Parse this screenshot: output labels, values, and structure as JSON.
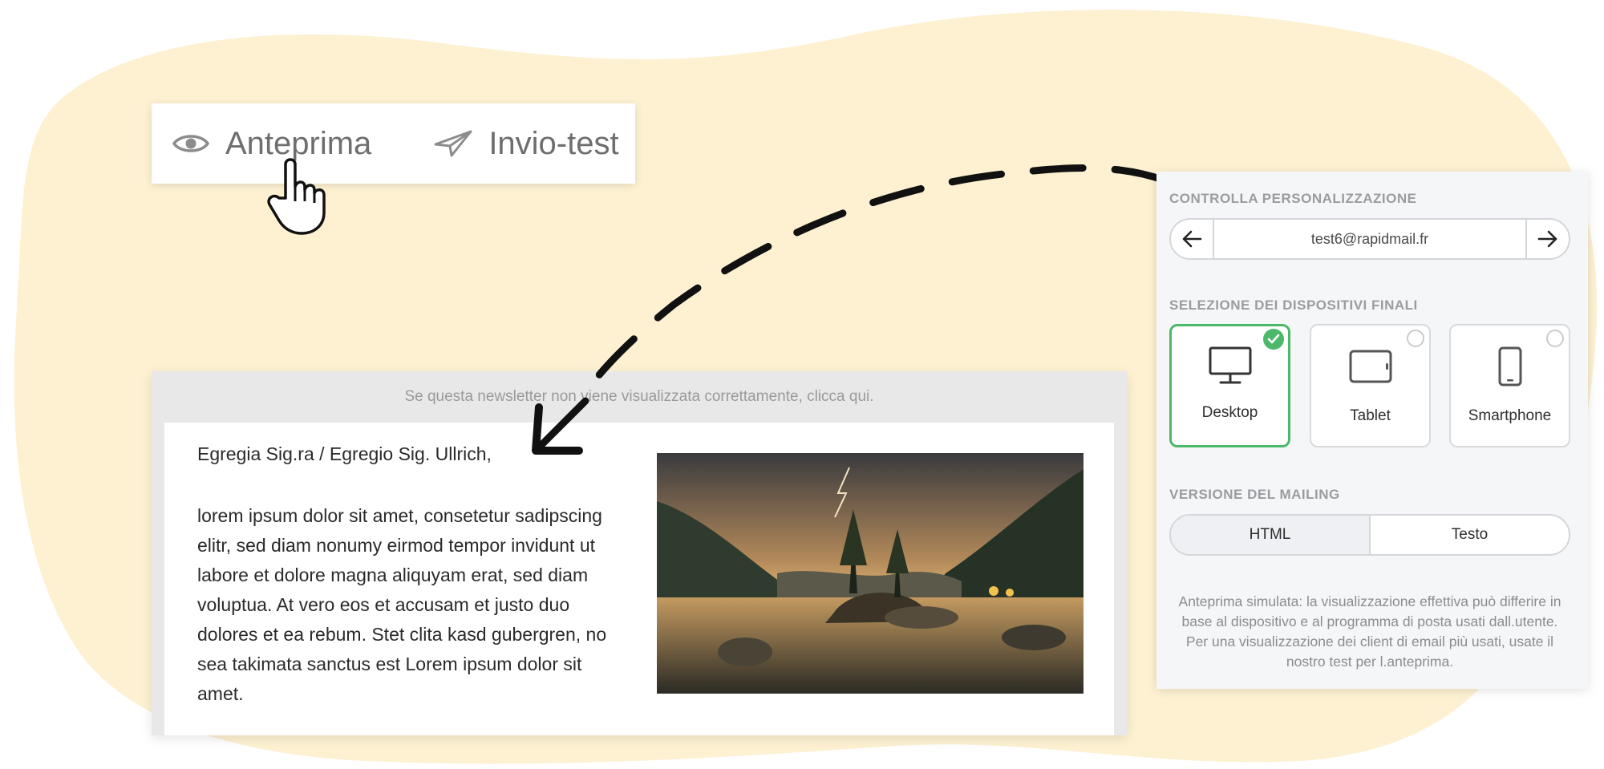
{
  "toolbar": {
    "preview_label": "Anteprima",
    "test_label": "Invio-test"
  },
  "preview": {
    "notice": "Se questa newsletter non viene visualizzata correttamente, clicca qui.",
    "greeting": "Egregia Sig.ra / Egregio Sig. Ullrich,",
    "body": "lorem ipsum dolor sit amet, consetetur sadipscing elitr, sed diam nonumy eirmod tempor invidunt ut labore et dolore magna aliquyam erat, sed diam voluptua. At vero eos et accusam et justo duo dolores et ea rebum. Stet clita kasd gubergren, no sea takimata sanctus est Lorem ipsum dolor sit amet."
  },
  "panel": {
    "personalization_title": "CONTROLLA PERSONALIZZAZIONE",
    "email": "test6@rapidmail.fr",
    "devices_title": "SELEZIONE DEI DISPOSITIVI FINALI",
    "devices": [
      {
        "label": "Desktop",
        "icon": "desktop-icon",
        "selected": true
      },
      {
        "label": "Tablet",
        "icon": "tablet-icon",
        "selected": false
      },
      {
        "label": "Smartphone",
        "icon": "smartphone-icon",
        "selected": false
      }
    ],
    "version_title": "VERSIONE DEL MAILING",
    "version_html": "HTML",
    "version_text": "Testo",
    "note": "Anteprima simulata: la visualizzazione effettiva può differire in base al dispositivo e al programma di posta usati dall.utente. Per una visualizzazione dei client di email più usati, usate il nostro test per l.anteprima."
  },
  "colors": {
    "blob": "#fdf1d2",
    "accent_green": "#4cb86a",
    "arrow": "#111111"
  }
}
